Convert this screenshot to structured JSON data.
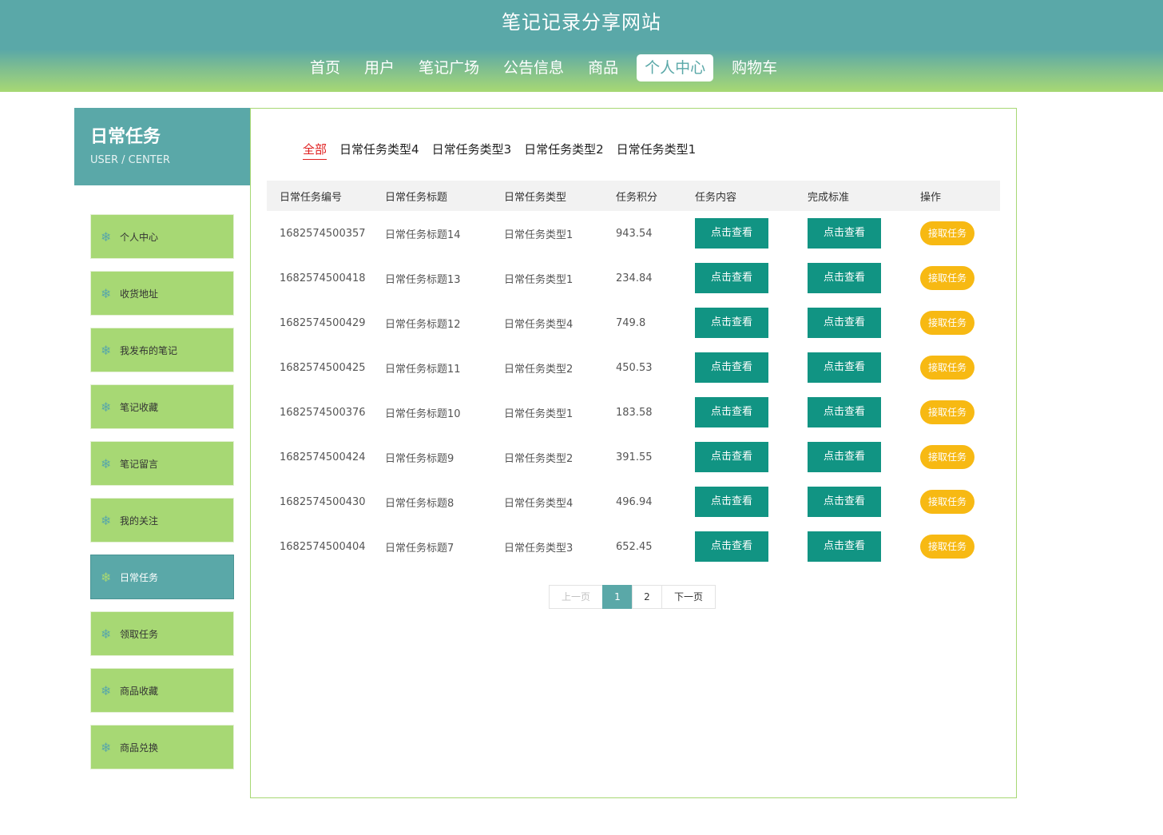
{
  "header": {
    "site_title": "笔记记录分享网站",
    "nav": [
      "首页",
      "用户",
      "笔记广场",
      "公告信息",
      "商品",
      "个人中心",
      "购物车"
    ],
    "active_nav": "个人中心"
  },
  "sidebar": {
    "title": "日常任务",
    "subtitle": "USER / CENTER",
    "items": [
      {
        "label": "个人中心"
      },
      {
        "label": "收货地址"
      },
      {
        "label": "我发布的笔记"
      },
      {
        "label": "笔记收藏"
      },
      {
        "label": "笔记留言"
      },
      {
        "label": "我的关注"
      },
      {
        "label": "日常任务"
      },
      {
        "label": "领取任务"
      },
      {
        "label": "商品收藏"
      },
      {
        "label": "商品兑换"
      }
    ],
    "active_item": "日常任务",
    "icon": "snowflake-icon"
  },
  "filters": [
    "全部",
    "日常任务类型4",
    "日常任务类型3",
    "日常任务类型2",
    "日常任务类型1"
  ],
  "active_filter": "全部",
  "table": {
    "headers": [
      "日常任务编号",
      "日常任务标题",
      "日常任务类型",
      "任务积分",
      "任务内容",
      "完成标准",
      "操作"
    ],
    "view_label": "点击查看",
    "take_label": "接取任务",
    "rows": [
      {
        "id": "1682574500357",
        "title": "日常任务标题14",
        "type": "日常任务类型1",
        "points": "943.54"
      },
      {
        "id": "1682574500418",
        "title": "日常任务标题13",
        "type": "日常任务类型1",
        "points": "234.84"
      },
      {
        "id": "1682574500429",
        "title": "日常任务标题12",
        "type": "日常任务类型4",
        "points": "749.8"
      },
      {
        "id": "1682574500425",
        "title": "日常任务标题11",
        "type": "日常任务类型2",
        "points": "450.53"
      },
      {
        "id": "1682574500376",
        "title": "日常任务标题10",
        "type": "日常任务类型1",
        "points": "183.58"
      },
      {
        "id": "1682574500424",
        "title": "日常任务标题9",
        "type": "日常任务类型2",
        "points": "391.55"
      },
      {
        "id": "1682574500430",
        "title": "日常任务标题8",
        "type": "日常任务类型4",
        "points": "496.94"
      },
      {
        "id": "1682574500404",
        "title": "日常任务标题7",
        "type": "日常任务类型3",
        "points": "652.45"
      }
    ]
  },
  "pagination": {
    "prev": "上一页",
    "pages": [
      "1",
      "2"
    ],
    "current": "1",
    "next": "下一页"
  },
  "colors": {
    "primary": "#5aa8a8",
    "green": "#a7d874",
    "button_teal": "#119483",
    "button_orange": "#f7b913",
    "filter_active": "#e02020"
  }
}
